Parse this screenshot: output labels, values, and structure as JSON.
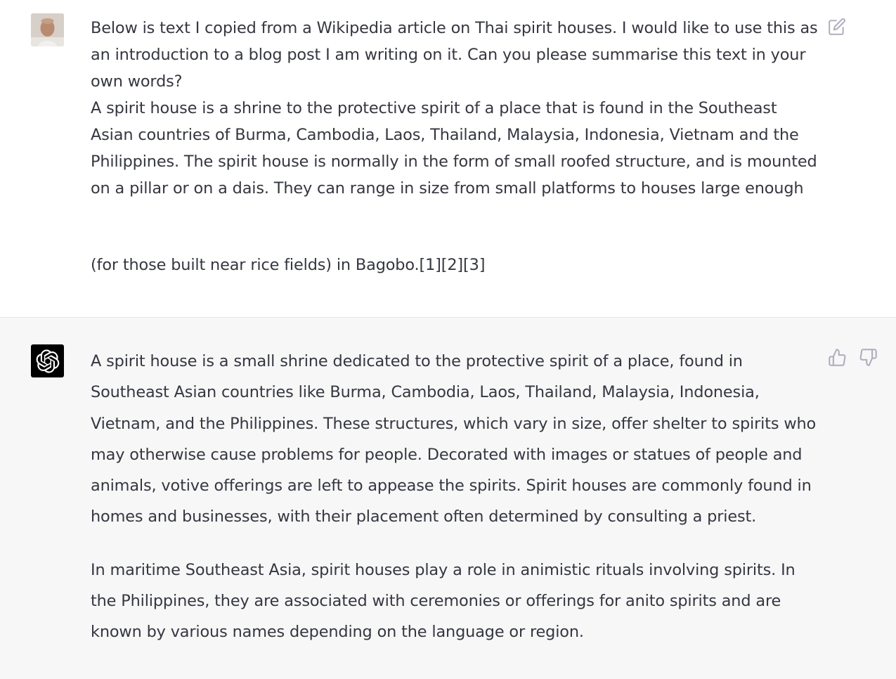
{
  "user_message": {
    "paragraph_1": "Below is text I copied from a Wikipedia article on Thai spirit houses. I would like to use this as an introduction to a blog post I am writing on it. Can you please summarise this text in your own words?",
    "paragraph_2": "A spirit house is a shrine to the protective spirit of a place that is found in the Southeast Asian countries of Burma, Cambodia, Laos, Thailand, Malaysia, Indonesia, Vietnam and the Philippines. The spirit house is normally in the form of small roofed structure, and is mounted on a pillar or on a dais. They can range in size from small platforms to houses large enough fo",
    "paragraph_2_end": "(for those built near rice fields) in Bagobo.[1][2][3]",
    "avatar": "user-photo-avatar",
    "edit_icon": "edit-icon"
  },
  "assistant_message": {
    "paragraph_1": "A spirit house is a small shrine dedicated to the protective spirit of a place, found in Southeast Asian countries like Burma, Cambodia, Laos, Thailand, Malaysia, Indonesia, Vietnam, and the Philippines. These structures, which vary in size, offer shelter to spirits who may otherwise cause problems for people. Decorated with images or statues of people and animals, votive offerings are left to appease the spirits. Spirit houses are commonly found in homes and businesses, with their placement often determined by consulting a priest.",
    "paragraph_2": "In maritime Southeast Asia, spirit houses play a role in animistic rituals involving spirits. In the Philippines, they are associated with ceremonies or offerings for anito spirits and are known by various names depending on the language or region.",
    "avatar": "openai-logo-icon",
    "thumbs_up_icon": "thumbs-up-icon",
    "thumbs_down_icon": "thumbs-down-icon"
  },
  "colors": {
    "text": "#353740",
    "assistant_bg": "#f7f7f8",
    "icon": "#acacbe",
    "divider": "#e5e5e6"
  }
}
